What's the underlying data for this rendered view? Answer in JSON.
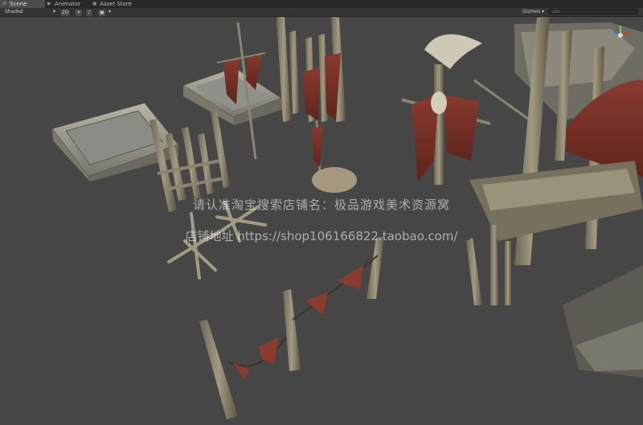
{
  "tabs": [
    {
      "label": "Scene",
      "icon": "scene-icon",
      "active": true
    },
    {
      "label": "Animator",
      "icon": "animator-icon",
      "active": false
    },
    {
      "label": "Asset Store",
      "icon": "store-icon",
      "active": false
    }
  ],
  "toolbar": {
    "shading_mode": "Shaded",
    "mode_2d": "2D",
    "gizmos_label": "Gizmos",
    "search_placeholder": "⊙All"
  },
  "watermark": {
    "line1": "请认准淘宝搜索店铺名：极品游戏美术资源窝",
    "line2": "店铺地址 https://shop106166822.taobao.com/"
  },
  "colors": {
    "viewport_bg": "#464646",
    "tab_bar": "#282828",
    "toolbar": "#353535",
    "gizmo_y": "#78c85a",
    "gizmo_x": "#d23c3c",
    "gizmo_z": "#4f7ddc"
  }
}
